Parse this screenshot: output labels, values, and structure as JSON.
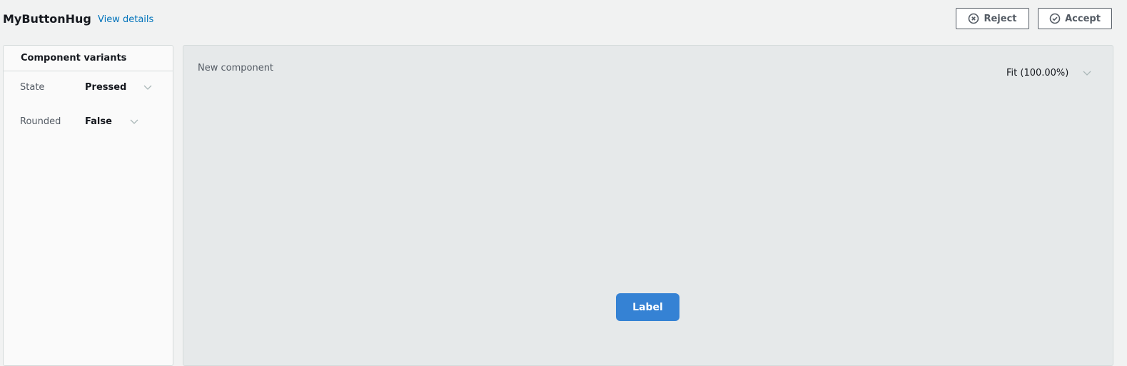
{
  "header": {
    "title": "MyButtonHug",
    "view_details": "View details",
    "reject": "Reject",
    "accept": "Accept"
  },
  "sidebar": {
    "title": "Component variants",
    "variants": [
      {
        "label": "State",
        "value": "Pressed"
      },
      {
        "label": "Rounded",
        "value": "False"
      }
    ]
  },
  "canvas": {
    "title": "New component",
    "zoom": "Fit (100.00%)",
    "preview_button_label": "Label"
  },
  "colors": {
    "link": "#0073bb",
    "preview_button": "#3582d4"
  }
}
